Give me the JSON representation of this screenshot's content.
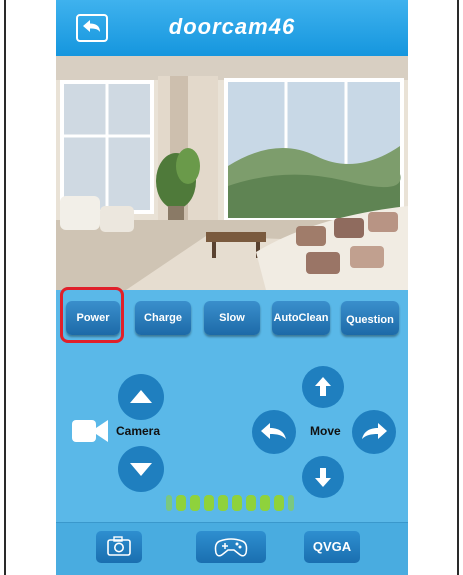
{
  "header": {
    "title": "doorcam46"
  },
  "function_buttons": [
    "Power",
    "Charge",
    "Slow",
    "AutoClean",
    "Question"
  ],
  "controls": {
    "camera_label": "Camera",
    "move_label": "Move"
  },
  "bottom": {
    "quality_label": "QVGA"
  },
  "colors": {
    "accent": "#1596de",
    "highlight": "#e0202a",
    "speed_bar": "#8fd23c"
  }
}
